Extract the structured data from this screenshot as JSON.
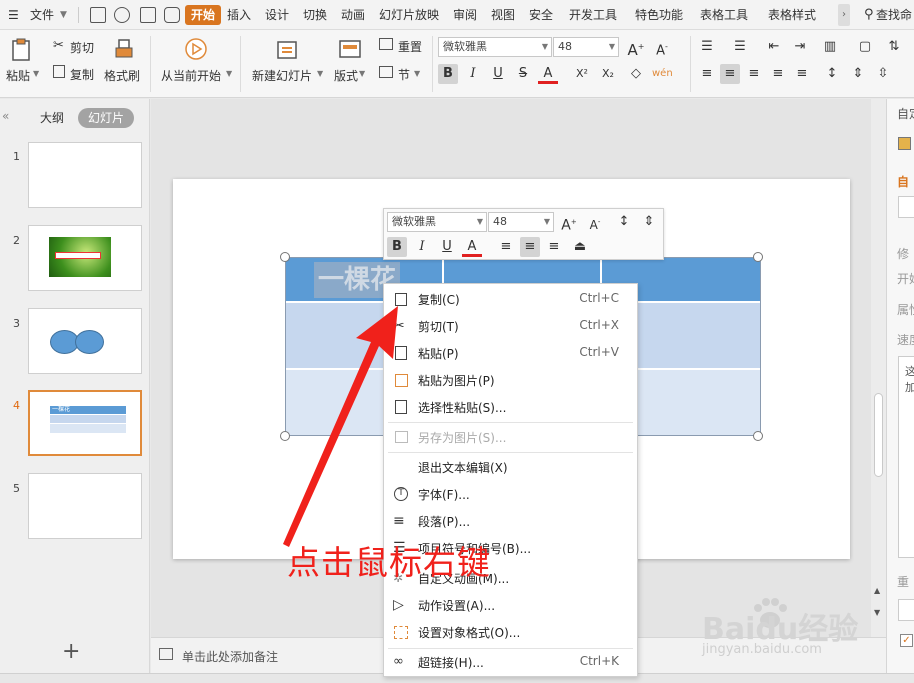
{
  "menubar": {
    "file": "文件",
    "tabs": [
      "开始",
      "插入",
      "设计",
      "切换",
      "动画",
      "幻灯片放映",
      "审阅",
      "视图",
      "安全",
      "开发工具",
      "特色功能",
      "表格工具",
      "表格样式"
    ],
    "search": "查找命"
  },
  "ribbon": {
    "paste": "粘贴",
    "cut": "剪切",
    "copy": "复制",
    "format_painter": "格式刷",
    "from_current": "从当前开始",
    "new_slide": "新建幻灯片",
    "layout": "版式",
    "reset": "重置",
    "section": "节",
    "font_name": "微软雅黑",
    "font_size": "48"
  },
  "left_panel": {
    "tab_outline": "大纲",
    "tab_slides": "幻灯片",
    "slide_numbers": [
      "1",
      "2",
      "3",
      "4",
      "5"
    ],
    "slide4_header": "一棵花",
    "add_icon": "+"
  },
  "slide": {
    "table_header_text": "一棵花"
  },
  "mini_toolbar": {
    "font_name": "微软雅黑",
    "font_size": "48"
  },
  "context_menu": {
    "items": [
      {
        "label": "复制(C)",
        "shortcut": "Ctrl+C",
        "icon": "copy-icon"
      },
      {
        "label": "剪切(T)",
        "shortcut": "Ctrl+X",
        "icon": "cut-icon"
      },
      {
        "label": "粘贴(P)",
        "shortcut": "Ctrl+V",
        "icon": "paste-icon"
      },
      {
        "label": "粘贴为图片(P)",
        "shortcut": "",
        "icon": "paste-as-picture-icon"
      },
      {
        "label": "选择性粘贴(S)...",
        "shortcut": "",
        "icon": "paste-special-icon"
      },
      {
        "label": "另存为图片(S)...",
        "shortcut": "",
        "icon": "save-as-picture-icon",
        "disabled": true
      },
      {
        "label": "退出文本编辑(X)",
        "shortcut": "",
        "icon": ""
      },
      {
        "label": "字体(F)...",
        "shortcut": "",
        "icon": "font-icon"
      },
      {
        "label": "段落(P)...",
        "shortcut": "",
        "icon": "paragraph-icon"
      },
      {
        "label": "项目符号和编号(B)...",
        "shortcut": "",
        "icon": "bullets-icon"
      },
      {
        "label": "自定义动画(M)...",
        "shortcut": "",
        "icon": "custom-animation-icon"
      },
      {
        "label": "动作设置(A)...",
        "shortcut": "",
        "icon": "action-icon"
      },
      {
        "label": "设置对象格式(O)...",
        "shortcut": "",
        "icon": "object-format-icon"
      },
      {
        "label": "超链接(H)...",
        "shortcut": "Ctrl+K",
        "icon": "hyperlink-icon"
      }
    ]
  },
  "notes": {
    "placeholder": "单击此处添加备注"
  },
  "right_panel": {
    "labels": [
      "自定",
      "自",
      "修",
      "开始",
      "属性",
      "速度",
      "重",
      "这",
      "加"
    ]
  },
  "annotation": {
    "text": "点击鼠标右键"
  },
  "watermark": {
    "brand": "Baidu经验",
    "url": "jingyan.baidu.com"
  },
  "colors": {
    "accent": "#d9751f",
    "table_header": "#5b9bd5",
    "table_row": "#c6d7ee",
    "annotation": "#f0211b"
  }
}
